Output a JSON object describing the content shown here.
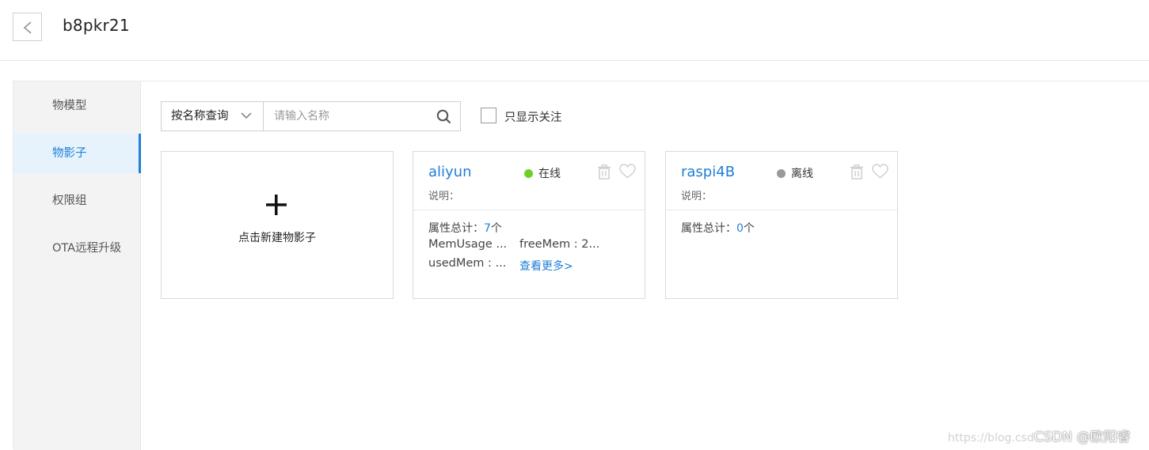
{
  "header": {
    "title": "b8pkr21"
  },
  "sidebar": {
    "items": [
      {
        "label": "物模型"
      },
      {
        "label": "物影子"
      },
      {
        "label": "权限组"
      },
      {
        "label": "OTA远程升级"
      }
    ]
  },
  "toolbar": {
    "select_value": "按名称查询",
    "search_placeholder": "请输入名称",
    "checkbox_label": "只显示关注"
  },
  "add_card": {
    "label": "点击新建物影子"
  },
  "cards": [
    {
      "name": "aliyun",
      "status": "在线",
      "status_color": "#6fcf2a",
      "desc": "说明：",
      "prop_total_prefix": "属性总计：",
      "prop_count": "7",
      "prop_unit": "个",
      "props": [
        "MemUsage ...",
        "freeMem : 2...",
        "usedMem : ..."
      ],
      "more": "查看更多>"
    },
    {
      "name": "raspi4B",
      "status": "离线",
      "status_color": "#999999",
      "desc": "说明：",
      "prop_total_prefix": "属性总计：",
      "prop_count": "0",
      "prop_unit": "个",
      "props": [],
      "more": ""
    }
  ],
  "watermark": {
    "url": "https://blog.csd",
    "brand": "CSDN @欧阳睿"
  },
  "colors": {
    "accent": "#1f7ed6",
    "online": "#6fcf2a",
    "offline": "#999999"
  }
}
